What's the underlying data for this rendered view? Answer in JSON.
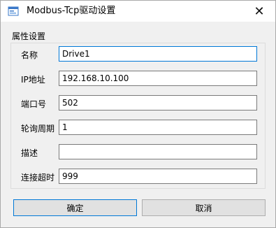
{
  "window": {
    "title": "Modbus-Tcp驱动设置",
    "close_glyph": "✕"
  },
  "group": {
    "title": "属性设置",
    "fields": [
      {
        "label": "名称",
        "value": "Drive1"
      },
      {
        "label": "IP地址",
        "value": "192.168.10.100"
      },
      {
        "label": "端口号",
        "value": "502"
      },
      {
        "label": "轮询周期",
        "value": "1"
      },
      {
        "label": "描述",
        "value": ""
      },
      {
        "label": "连接超时",
        "value": "999"
      }
    ]
  },
  "buttons": {
    "ok_label": "确定",
    "cancel_label": "取消"
  },
  "colors": {
    "focus_accent": "#0078d7",
    "dialog_bg": "#f0f0f0"
  },
  "icons": {
    "app": "settings-window-icon",
    "close": "close-icon"
  }
}
